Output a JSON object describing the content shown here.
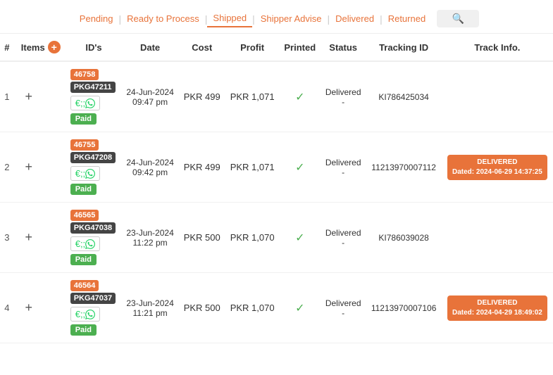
{
  "nav": {
    "items": [
      {
        "label": "Pending",
        "active": false
      },
      {
        "label": "Ready to Process",
        "active": false
      },
      {
        "label": "Shipped",
        "active": true
      },
      {
        "label": "Shipper Advise",
        "active": false
      },
      {
        "label": "Delivered",
        "active": false
      },
      {
        "label": "Returned",
        "active": false
      }
    ],
    "search_placeholder": "Search"
  },
  "table": {
    "headers": {
      "num": "#",
      "items": "Items",
      "ids": "ID's",
      "date": "Date",
      "cost": "Cost",
      "profit": "Profit",
      "printed": "Printed",
      "status": "Status",
      "tracking_id": "Tracking ID",
      "track_info": "Track Info."
    },
    "rows": [
      {
        "num": "1",
        "badge_id": "46758",
        "badge_pkg": "PKG47211",
        "date": "24-Jun-2024",
        "time": "09:47 pm",
        "cost": "PKR 499",
        "profit": "PKR 1,071",
        "printed": true,
        "status": "Delivered",
        "status_dash": "-",
        "tracking_id": "KI786425034",
        "track_info": null
      },
      {
        "num": "2",
        "badge_id": "46755",
        "badge_pkg": "PKG47208",
        "date": "24-Jun-2024",
        "time": "09:42 pm",
        "cost": "PKR 499",
        "profit": "PKR 1,071",
        "printed": true,
        "status": "Delivered",
        "status_dash": "-",
        "tracking_id": "11213970007112",
        "track_info": "DELIVERED\nDated: 2024-06-29 14:37:25"
      },
      {
        "num": "3",
        "badge_id": "46565",
        "badge_pkg": "PKG47038",
        "date": "23-Jun-2024",
        "time": "11:22 pm",
        "cost": "PKR 500",
        "profit": "PKR 1,070",
        "printed": true,
        "status": "Delivered",
        "status_dash": "-",
        "tracking_id": "KI786039028",
        "track_info": null
      },
      {
        "num": "4",
        "badge_id": "46564",
        "badge_pkg": "PKG47037",
        "date": "23-Jun-2024",
        "time": "11:21 pm",
        "cost": "PKR 500",
        "profit": "PKR 1,070",
        "printed": true,
        "status": "Delivered",
        "status_dash": "-",
        "tracking_id": "11213970007106",
        "track_info": "DELIVERED\nDated: 2024-04-29 18:49:02"
      }
    ]
  }
}
